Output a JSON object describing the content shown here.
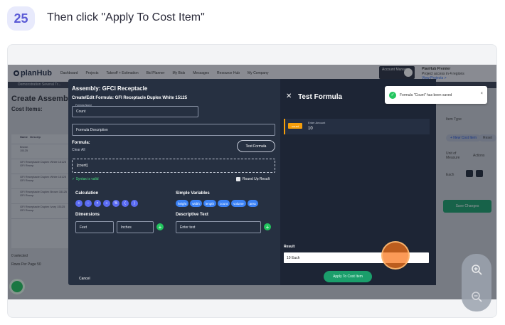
{
  "step": {
    "number": "25",
    "instruction": "Then click \"Apply To Cost Item\""
  },
  "app": {
    "logo": "planHub",
    "nav": [
      "Dashboard",
      "Projects",
      "Takeoff + Estimation",
      "Bid Planner",
      "My Bids",
      "Messages",
      "Resource Hub",
      "My Company"
    ],
    "account": "Account Manager",
    "plan": {
      "title": "PlanHub Premier",
      "line1": "Project access in 4 regions",
      "line2": "View Projects >"
    },
    "subbar": "Demonstration Several Tr...",
    "page_title": "Create Assembl",
    "cost_items_label": "Cost Items:",
    "table_header": [
      "Name",
      "Descrip"
    ],
    "rows": [
      [
        "Brown",
        "15125"
      ],
      [
        "GFI Receptacle Duplex White 15125",
        "GFI Recep"
      ],
      [
        "GFI Receptacle Duplex White 15125",
        "GFI Recep"
      ],
      [
        "GFI Receptacle Duplex Brown 15125",
        "GFI Recep"
      ],
      [
        "GFI Receptacle Duplex Ivory 15125",
        "GFI Recep"
      ]
    ],
    "footer_total": "0 selected",
    "rows_per_page": "Rows Per Page",
    "rows_value": "50",
    "right_col": {
      "dropdown": "Item Type",
      "new_btn": "+ New Cost Item",
      "reset": "Reset",
      "unit_label": "Unit of Measure",
      "actions": "Actions",
      "unit_value": "Each"
    },
    "save_changes": "Save Changes"
  },
  "modal": {
    "title": "Assembly: GFCI Receptacle",
    "subtitle": "Create/Edit Formula: GFI Receptacle Duplex White 15125",
    "formula_name_label": "Formula Name",
    "formula_name": "Count",
    "description_placeholder": "Formula Description",
    "formula_label": "Formula:",
    "clear_all": "Clear All",
    "test_formula_btn": "Test Formula",
    "formula_value": "[count]",
    "syntax_valid": "Syntax is valid",
    "round_up": "Round Up Result",
    "calculation_label": "Calculation",
    "operators": [
      "+",
      "−",
      "×",
      "÷",
      "%",
      "(",
      ")"
    ],
    "simple_vars_label": "Simple Variables",
    "variables": [
      "height",
      "width",
      "length",
      "count",
      "volume",
      "area"
    ],
    "dimensions_label": "Dimensions",
    "dim_feet": "Feet",
    "dim_inches": "Inches",
    "descriptive_label": "Descriptive Text",
    "descriptive_placeholder": "Enter text",
    "cancel": "Cancel"
  },
  "panel": {
    "close": "✕",
    "title": "Test Formula",
    "item_tag": "count",
    "item_label": "Enter Amount",
    "item_value": "10",
    "result_label": "Result",
    "result_value": "10 Each",
    "apply_button": "Apply To Cost Item"
  },
  "toast": {
    "message": "Formula \"Count\" has been saved",
    "close": "×"
  },
  "colors": {
    "accent": "#5b5bd6",
    "primary_green": "#1b9e6b",
    "modal_bg": "#263041",
    "panel_bg": "#1d2535",
    "click_indicator": "#f97316"
  }
}
